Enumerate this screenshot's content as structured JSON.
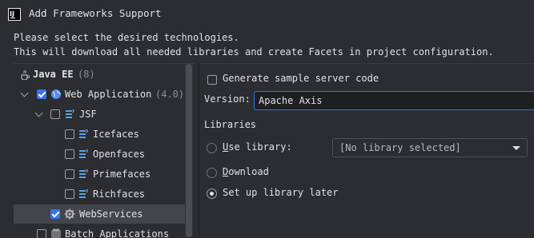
{
  "window": {
    "title": "Add Frameworks Support"
  },
  "instructions": {
    "line1": "Please select the desired technologies.",
    "line2": "This will download all needed libraries and create Facets in project configuration."
  },
  "tree": {
    "group": {
      "label": "Java EE",
      "count": "(8)"
    },
    "items": [
      {
        "label": "Web Application",
        "suffix": "(4.0)",
        "checked": true,
        "icon": "globe-icon"
      },
      {
        "label": "JSF",
        "checked": false,
        "icon": "jsf-icon"
      },
      {
        "label": "Icefaces",
        "checked": false,
        "icon": "jsf-icon"
      },
      {
        "label": "Openfaces",
        "checked": false,
        "icon": "jsf-icon"
      },
      {
        "label": "Primefaces",
        "checked": false,
        "icon": "jsf-icon"
      },
      {
        "label": "Richfaces",
        "checked": false,
        "icon": "jsf-icon"
      },
      {
        "label": "WebServices",
        "checked": true,
        "icon": "gear-icon",
        "selected": true
      },
      {
        "label": "Batch Applications",
        "checked": false,
        "icon": "batch-icon"
      }
    ]
  },
  "details": {
    "generate_sample": {
      "label": "Generate sample server code",
      "checked": false
    },
    "version": {
      "label": "Version:",
      "value": "Apache Axis"
    },
    "libraries": {
      "heading": "Libraries",
      "use_library": {
        "label_u": "U",
        "label_rest": "se library:",
        "selected": false,
        "enabled": false
      },
      "library_select": {
        "value": "[No library selected]"
      },
      "download": {
        "label_u": "D",
        "label_rest": "ownload",
        "selected": false
      },
      "setup_later": {
        "label": "Set up library later",
        "selected": true
      }
    }
  },
  "colors": {
    "accent": "#3574f0",
    "background": "#2b2d30",
    "text": "#dfe1e5"
  }
}
